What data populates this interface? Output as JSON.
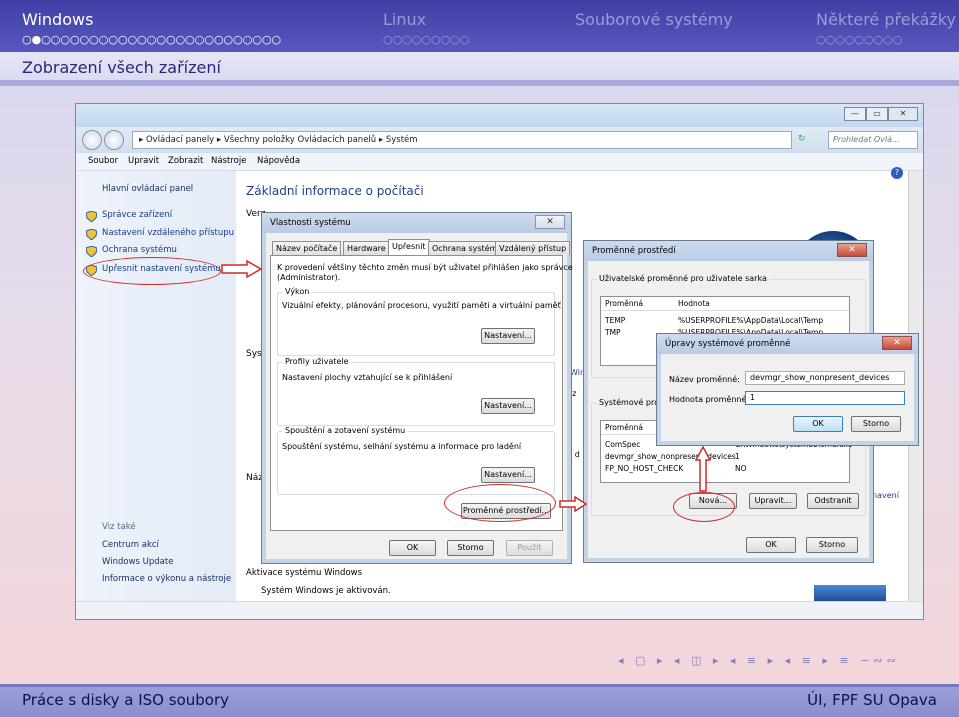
{
  "slide": {
    "sections": [
      "Windows",
      "Linux",
      "Souborové systémy",
      "Některé překážky"
    ],
    "dots": [
      "○●○○○○○○○○○○○○○○○○○○○○○○○○○",
      "○○○○○○○○○",
      "○○○○○○○○○"
    ],
    "frame_title": "Zobrazení všech zařízení",
    "footer_left": "Práce s disky a ISO soubory",
    "footer_right": "ÚI, FPF SU Opava",
    "nav_symbols": "◂ ▢ ▸ ◂ ◫ ▸ ◂ ≡ ▸ ◂ ≡ ▸ ≡ ∽∾∾"
  },
  "window": {
    "address": "▸  Ovládací panely  ▸  Všechny položky Ovládacích panelů  ▸  Systém",
    "search_placeholder": "Prohledat Ovlá...",
    "menu": [
      "Soubor",
      "Upravit",
      "Zobrazit",
      "Nástroje",
      "Nápověda"
    ],
    "sidebar_top": "Hlavní ovládací panel",
    "sidebar_links": [
      "Správce zařízení",
      "Nastavení vzdáleného přístupu",
      "Ochrana systému",
      "Upřesnit nastavení systému"
    ],
    "see_also_title": "Viz také",
    "see_also": [
      "Centrum akcí",
      "Windows Update",
      "Informace o výkonu a nástroje"
    ],
    "main_heading": "Základní informace o počítači",
    "frag_versions": "Verz",
    "frag_system": "Syst",
    "frag_name": "Náz",
    "frag_win": "Win",
    "frag_iz": "iz",
    "frag_id": "i d",
    "frag_navi": "navení",
    "activation_title": "Aktivace systému Windows",
    "activation_text": "Systém Windows je aktivován."
  },
  "sys_props": {
    "title": "Vlastnosti systému",
    "tabs": [
      "Název počítače",
      "Hardware",
      "Upřesnit",
      "Ochrana systému",
      "Vzdálený přístup"
    ],
    "admin_note_1": "K provedení většiny těchto změn musí být uživatel přihlášen jako správce",
    "admin_note_2": "(Administrator).",
    "perf_label": "Výkon",
    "perf_text": "Vizuální efekty, plánování procesoru, využití paměti a virtuální paměť",
    "profiles_label": "Profily uživatele",
    "profiles_text": "Nastavení plochy vztahující se k přihlášení",
    "startup_label": "Spouštění a zotavení systému",
    "startup_text": "Spouštění systému, selhání systému a informace pro ladění",
    "settings_btn": "Nastavení...",
    "env_btn": "Proměnné prostředí...",
    "ok": "OK",
    "cancel": "Storno",
    "apply": "Použít"
  },
  "env_vars": {
    "title": "Proměnné prostředí",
    "user_group": "Uživatelské proměnné pro uživatele sarka",
    "col_name": "Proměnná",
    "col_value": "Hodnota",
    "user_rows": [
      {
        "name": "TEMP",
        "value": "%USERPROFILE%\\AppData\\Local\\Temp"
      },
      {
        "name": "TMP",
        "value": "%USERPROFILE%\\AppData\\Local\\Temp"
      }
    ],
    "sys_group": "Systémové pro",
    "sys_rows": [
      {
        "name": "ComSpec",
        "value": "C:\\Windows\\system32\\cmd.exe"
      },
      {
        "name": "devmgr_show_nonpresent_devices",
        "value": "1"
      },
      {
        "name": "FP_NO_HOST_CHECK",
        "value": "NO"
      }
    ],
    "new_btn": "Nová...",
    "edit_btn": "Upravit...",
    "delete_btn": "Odstranit",
    "ok": "OK",
    "cancel": "Storno"
  },
  "edit_var": {
    "title": "Úpravy systémové proměnné",
    "name_label": "Název proměnné:",
    "name_value": "devmgr_show_nonpresent_devices",
    "value_label": "Hodnota proměnné:",
    "value_value": "1",
    "ok": "OK",
    "cancel": "Storno"
  }
}
